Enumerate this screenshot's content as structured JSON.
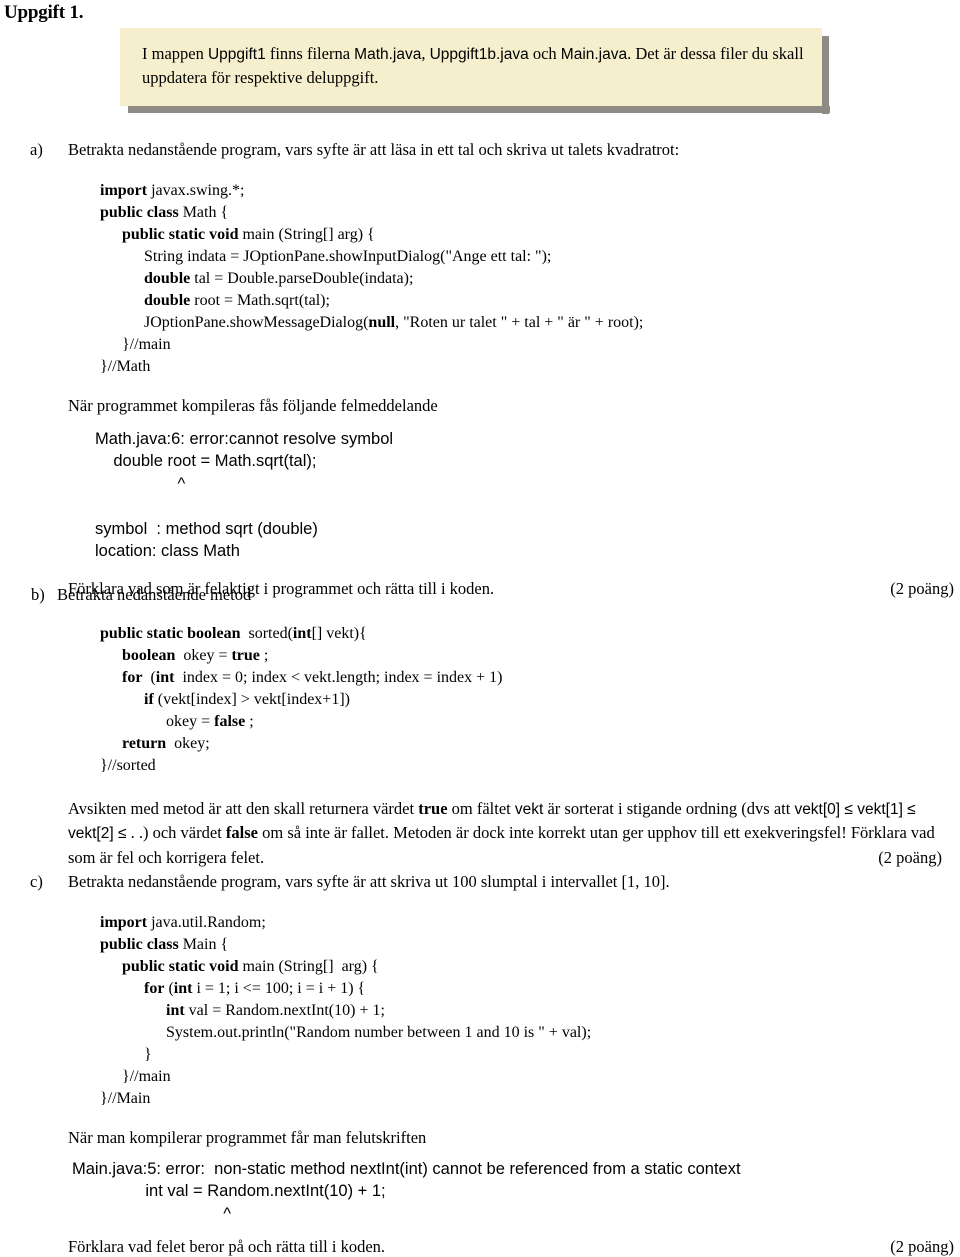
{
  "document": {
    "title": "Uppgift 1."
  },
  "callout": {
    "text_part1": "I mappen ",
    "folder": "Uppgift1",
    "text_part2": " finns filerna ",
    "file1": "Math.java",
    "sep1": ", ",
    "file2": "Uppgift1b.java",
    "sep2": " och ",
    "file3": "Main.java",
    "text_part3": ". Det är dessa filer du skall uppdatera för respektive deluppgift."
  },
  "sections": {
    "a": {
      "label": "a)",
      "intro": "Betrakta nedanstående program, vars syfte är att läsa in ett tal och skriva ut talets kvadratrot:",
      "code_lines": [
        {
          "indent": 0,
          "segments": [
            {
              "bold": true,
              "text": "import"
            },
            {
              "bold": false,
              "text": " javax.swing.*;"
            }
          ]
        },
        {
          "indent": 0,
          "segments": [
            {
              "bold": true,
              "text": "public class"
            },
            {
              "bold": false,
              "text": " Math {"
            }
          ]
        },
        {
          "indent": 1,
          "segments": [
            {
              "bold": true,
              "text": "public static void"
            },
            {
              "bold": false,
              "text": " main (String[] arg) {"
            }
          ]
        },
        {
          "indent": 2,
          "segments": [
            {
              "bold": false,
              "text": "String indata = JOptionPane.showInputDialog(\"Ange ett tal: \");"
            }
          ]
        },
        {
          "indent": 2,
          "segments": [
            {
              "bold": true,
              "text": "double"
            },
            {
              "bold": false,
              "text": " tal = Double.parseDouble(indata);"
            }
          ]
        },
        {
          "indent": 2,
          "segments": [
            {
              "bold": true,
              "text": "double"
            },
            {
              "bold": false,
              "text": " root = Math.sqrt(tal);"
            }
          ]
        },
        {
          "indent": 2,
          "segments": [
            {
              "bold": false,
              "text": "JOptionPane.showMessageDialog("
            },
            {
              "bold": true,
              "text": "null"
            },
            {
              "bold": false,
              "text": ", \"Roten ur talet \" + tal + \" är \" + root);"
            }
          ]
        },
        {
          "indent": 1,
          "segments": [
            {
              "bold": false,
              "text": "}//main"
            }
          ]
        },
        {
          "indent": 0,
          "segments": [
            {
              "bold": false,
              "text": "}//Math"
            }
          ]
        }
      ],
      "error_intro": "När programmet kompileras fås följande felmeddelande",
      "error_lines": [
        "Math.java:6: error:cannot resolve symbol",
        "    double root = Math.sqrt(tal);",
        "                  ^",
        "",
        "symbol  : method sqrt (double)",
        "location: class Math"
      ],
      "question": "Förklara vad som är felaktigt i programmet och rätta till i koden.",
      "points": "(2 poäng)"
    },
    "b": {
      "label": "b)",
      "intro": "Betrakta nedanstående metod",
      "code_lines": [
        {
          "indent": 0,
          "segments": [
            {
              "bold": true,
              "text": "public static boolean"
            },
            {
              "bold": false,
              "text": "  sorted("
            },
            {
              "bold": true,
              "text": "int"
            },
            {
              "bold": false,
              "text": "[] vekt){"
            }
          ]
        },
        {
          "indent": 1,
          "segments": [
            {
              "bold": true,
              "text": "boolean"
            },
            {
              "bold": false,
              "text": "  okey = "
            },
            {
              "bold": true,
              "text": "true"
            },
            {
              "bold": false,
              "text": " ;"
            }
          ]
        },
        {
          "indent": 1,
          "segments": [
            {
              "bold": true,
              "text": "for"
            },
            {
              "bold": false,
              "text": "  ("
            },
            {
              "bold": true,
              "text": "int"
            },
            {
              "bold": false,
              "text": "  index = 0; index < vekt.length; index = index + 1)"
            }
          ]
        },
        {
          "indent": 2,
          "segments": [
            {
              "bold": true,
              "text": "if"
            },
            {
              "bold": false,
              "text": " (vekt[index] > vekt[index+1])"
            }
          ]
        },
        {
          "indent": 3,
          "segments": [
            {
              "bold": false,
              "text": "okey = "
            },
            {
              "bold": true,
              "text": "false"
            },
            {
              "bold": false,
              "text": " ;"
            }
          ]
        },
        {
          "indent": 1,
          "segments": [
            {
              "bold": true,
              "text": "return"
            },
            {
              "bold": false,
              "text": "  okey;"
            }
          ]
        },
        {
          "indent": 0,
          "segments": [
            {
              "bold": false,
              "text": "}//sorted"
            }
          ]
        }
      ],
      "explanation": {
        "p1": "Avsikten med metod är att den skall returnera värdet ",
        "true_kw": "true",
        "p2": " om fältet ",
        "vekt_kw": "vekt",
        "p3": " är sorterat i stigande ordning (dvs att ",
        "ineq": "vekt[0] ≤ vekt[1] ≤  vekt[2] ≤",
        "p4": " . .) och värdet ",
        "false_kw": "false",
        "p5": " om så inte är fallet. Metoden  är dock inte korrekt utan ger upphov till ett exekveringsfel! Förklara vad som är fel och korrigera felet."
      },
      "points": "(2 poäng)"
    },
    "c": {
      "label": "c)",
      "intro": "Betrakta nedanstående program, vars syfte är att  skriva ut 100 slumptal i intervallet [1, 10].",
      "code_lines": [
        {
          "indent": 0,
          "segments": [
            {
              "bold": true,
              "text": "import"
            },
            {
              "bold": false,
              "text": " java.util.Random;"
            }
          ]
        },
        {
          "indent": 0,
          "segments": [
            {
              "bold": true,
              "text": "public class"
            },
            {
              "bold": false,
              "text": " Main {"
            }
          ]
        },
        {
          "indent": 1,
          "segments": [
            {
              "bold": true,
              "text": "public static void"
            },
            {
              "bold": false,
              "text": " main (String[]  arg) {"
            }
          ]
        },
        {
          "indent": 2,
          "segments": [
            {
              "bold": true,
              "text": "for"
            },
            {
              "bold": false,
              "text": " ("
            },
            {
              "bold": true,
              "text": "int"
            },
            {
              "bold": false,
              "text": " i = 1; i <= 100; i = i + 1) {"
            }
          ]
        },
        {
          "indent": 3,
          "segments": [
            {
              "bold": true,
              "text": "int"
            },
            {
              "bold": false,
              "text": " val = Random.nextInt(10) + 1;"
            }
          ]
        },
        {
          "indent": 3,
          "segments": [
            {
              "bold": false,
              "text": "System.out.println(\"Random number between 1 and 10 is \" + val);"
            }
          ]
        },
        {
          "indent": 2,
          "segments": [
            {
              "bold": false,
              "text": "}"
            }
          ]
        },
        {
          "indent": 1,
          "segments": [
            {
              "bold": false,
              "text": "}//main"
            }
          ]
        },
        {
          "indent": 0,
          "segments": [
            {
              "bold": false,
              "text": "}//Main"
            }
          ]
        }
      ],
      "error_intro": "När man kompilerar programmet får man felutskriften",
      "error_lines": [
        "Main.java:5: error:  non-static method nextInt(int) cannot be referenced from a static context",
        "                int val = Random.nextInt(10) + 1;",
        "                                 ^"
      ],
      "question": "Förklara vad felet beror på och rätta till i koden.",
      "points": "(2 poäng)"
    }
  }
}
